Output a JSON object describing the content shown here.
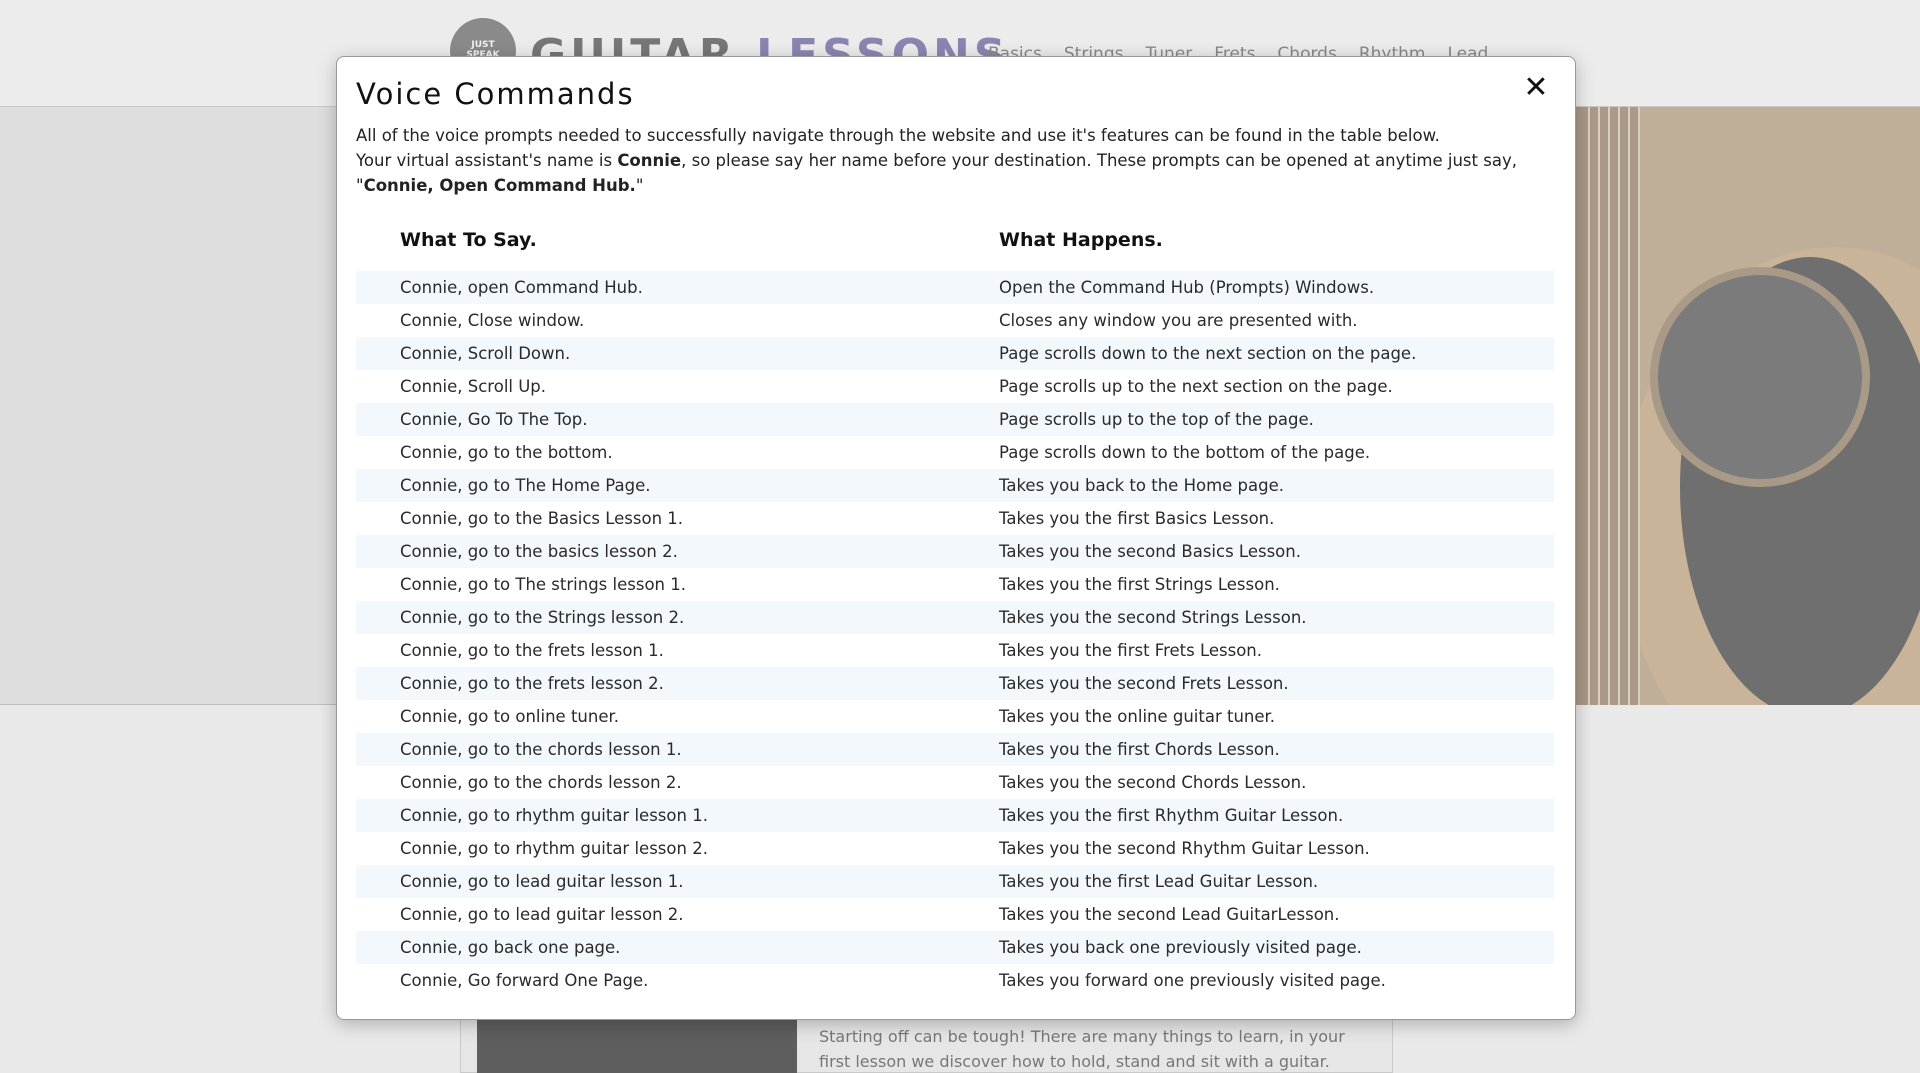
{
  "site": {
    "logo_badge": "JUST\nSPEAK",
    "logo_word1": "GUITAR",
    "logo_word2": "LESSONS",
    "nav": [
      "Basics",
      "Strings",
      "Tuner",
      "Frets",
      "Chords",
      "Rhythm",
      "Lead"
    ],
    "lower_card_text": "Starting off can be tough! There are many things to learn, in your first lesson we discover how to hold, stand and sit with a guitar."
  },
  "modal": {
    "title": "Voice Commands",
    "close_symbol": "✕",
    "intro_line1": "All of the voice prompts needed to successfully navigate through the website and use it's features can be found in the table below.",
    "intro_line2_a": "Your virtual assistant's name is ",
    "assistant_name": "Connie",
    "intro_line2_b": ", so please say her name before your destination. These prompts can be opened at anytime just say, \"",
    "open_phrase": "Connie, Open Command Hub.",
    "intro_line2_c": "\"",
    "col_say": "What To Say.",
    "col_happen": "What Happens.",
    "rows": [
      {
        "say": "Connie, open Command Hub.",
        "happen": "Open the Command Hub (Prompts) Windows."
      },
      {
        "say": "Connie, Close window.",
        "happen": "Closes any window you are presented with."
      },
      {
        "say": "Connie, Scroll Down.",
        "happen": "Page scrolls down to the next section on the page."
      },
      {
        "say": "Connie, Scroll Up.",
        "happen": "Page scrolls up to the next section on the page."
      },
      {
        "say": "Connie, Go To The Top.",
        "happen": "Page scrolls up to the top of the page."
      },
      {
        "say": "Connie, go to the bottom.",
        "happen": "Page scrolls down to the bottom of the page."
      },
      {
        "say": "Connie, go to The Home Page.",
        "happen": "Takes you back to the Home page."
      },
      {
        "say": "Connie, go to the Basics Lesson 1.",
        "happen": "Takes you the first Basics Lesson."
      },
      {
        "say": "Connie, go to the basics lesson 2.",
        "happen": "Takes you the second Basics Lesson."
      },
      {
        "say": "Connie, go to The strings lesson 1.",
        "happen": "Takes you the first Strings Lesson."
      },
      {
        "say": "Connie, go to the Strings lesson 2.",
        "happen": "Takes you the second Strings Lesson."
      },
      {
        "say": "Connie, go to the frets lesson 1.",
        "happen": "Takes you the first Frets Lesson."
      },
      {
        "say": "Connie, go to the frets lesson 2.",
        "happen": "Takes you the second Frets Lesson."
      },
      {
        "say": "Connie, go to online tuner.",
        "happen": "Takes you the online guitar tuner."
      },
      {
        "say": "Connie, go to the chords lesson 1.",
        "happen": "Takes you the first Chords Lesson."
      },
      {
        "say": "Connie, go to the chords lesson 2.",
        "happen": "Takes you the second Chords Lesson."
      },
      {
        "say": "Connie, go to rhythm guitar lesson 1.",
        "happen": "Takes you the first Rhythm Guitar Lesson."
      },
      {
        "say": "Connie, go to rhythm guitar lesson 2.",
        "happen": "Takes you the second Rhythm Guitar Lesson."
      },
      {
        "say": "Connie, go to lead guitar lesson 1.",
        "happen": "Takes you the first Lead Guitar Lesson."
      },
      {
        "say": "Connie, go to lead guitar lesson 2.",
        "happen": "Takes you the second Lead GuitarLesson."
      },
      {
        "say": "Connie, go back one page.",
        "happen": "Takes you back one previously visited page."
      },
      {
        "say": "Connie, Go forward One Page.",
        "happen": "Takes you forward one previously visited page."
      }
    ]
  }
}
